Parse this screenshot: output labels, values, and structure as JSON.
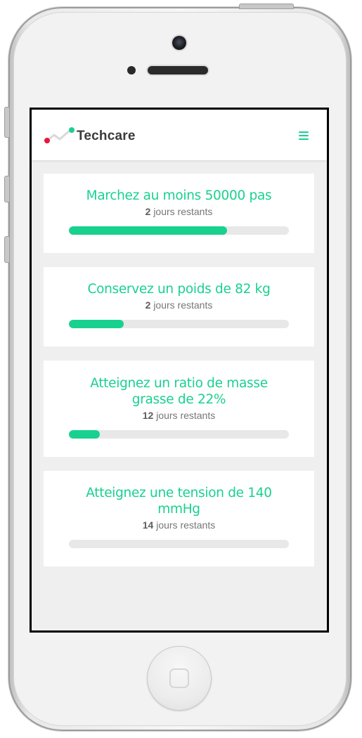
{
  "app": {
    "brand": "Techcare",
    "accent_color": "#19d18f",
    "logo_icon": "heartbeat-line-logo-icon",
    "menu_icon": "hamburger-menu-icon"
  },
  "goals": [
    {
      "title": "Marchez au moins 50000 pas",
      "days_count": "2",
      "days_label": "jours restants",
      "progress": 0.72
    },
    {
      "title": "Conservez un poids de 82 kg",
      "days_count": "2",
      "days_label": "jours restants",
      "progress": 0.25
    },
    {
      "title": "Atteignez un ratio de masse grasse de 22%",
      "days_count": "12",
      "days_label": "jours restants",
      "progress": 0.14
    },
    {
      "title": "Atteignez une tension de 140 mmHg",
      "days_count": "14",
      "days_label": "jours restants",
      "progress": 0.0
    }
  ]
}
